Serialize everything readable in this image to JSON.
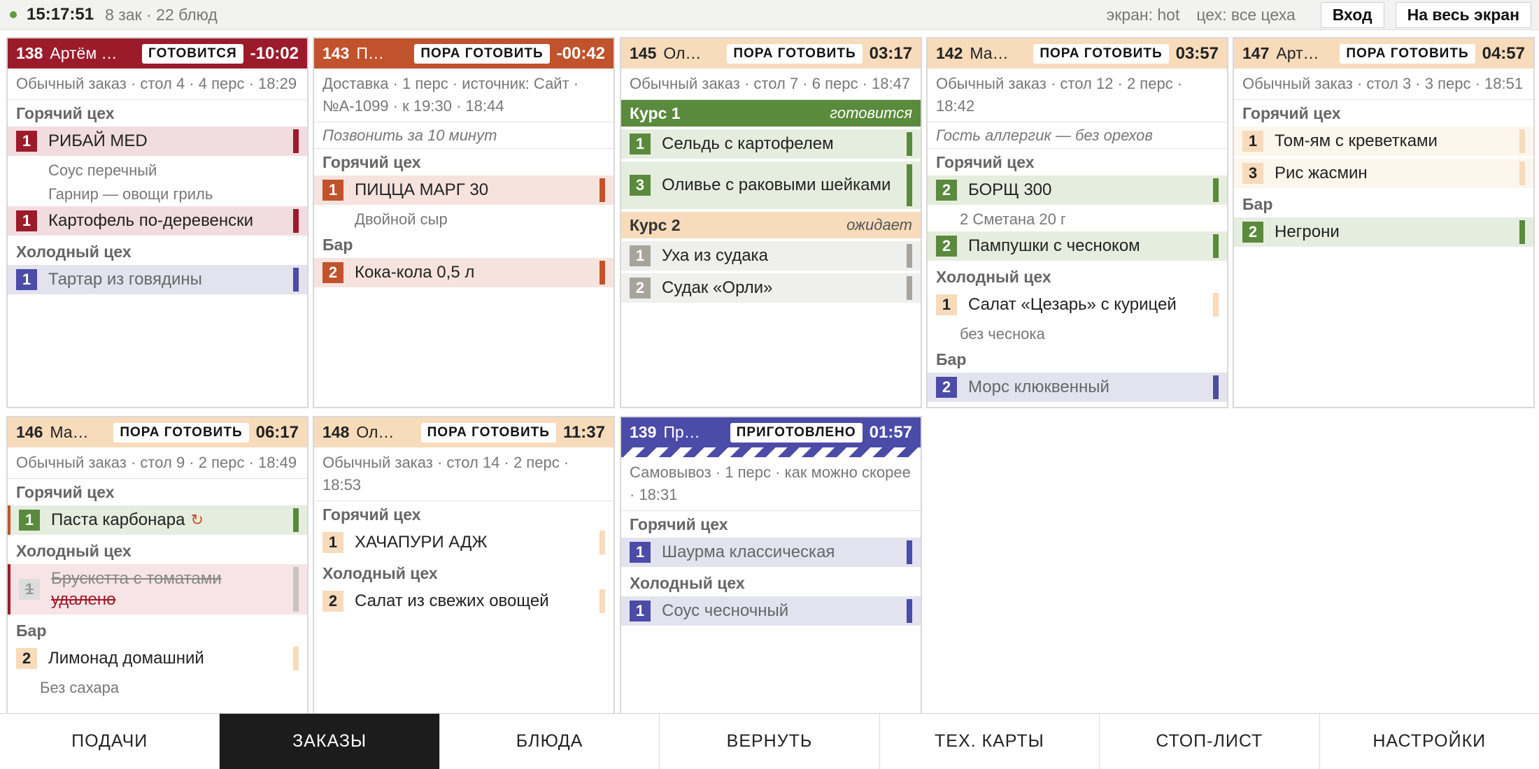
{
  "topbar": {
    "clock": "15:17:51",
    "summary": "8 зак · 22 блюд",
    "screen": "экран: hot",
    "shop": "цех: все цеха",
    "login_label": "Вход",
    "fullscreen_label": "На весь экран"
  },
  "orders": [
    {
      "num": "138",
      "name": "Артём …",
      "status": "ГОТОВИТСЯ",
      "timer": "-10:02",
      "info": "Обычный заказ  · стол 4  · 4 перс · 18:29",
      "sec1": "Горячий цех",
      "i1q": "1",
      "i1": "РИБАЙ MED",
      "m1": "Соус перечный",
      "m2": "Гарнир — овощи гриль",
      "i2q": "1",
      "i2": "Картофель по-деревенски",
      "sec2": "Холодный цех",
      "i3q": "1",
      "i3": "Тартар из говядины"
    },
    {
      "num": "143",
      "name": "П…",
      "status": "ПОРА ГОТОВИТЬ",
      "timer": "-00:42",
      "info": "Доставка  · 1 перс  · источник: Сайт · №A-1099  · к 19:30  · 18:44",
      "note": "Позвонить за 10 минут",
      "sec1": "Горячий цех",
      "i1q": "1",
      "i1": "ПИЦЦА МАРГ 30",
      "m1": "Двойной сыр",
      "sec2": "Бар",
      "i2q": "2",
      "i2": "Кока-кола 0,5 л"
    },
    {
      "num": "145",
      "name": "Ол…",
      "status": "ПОРА ГОТОВИТЬ",
      "timer": "03:17",
      "info": "Обычный заказ  · стол 7  · 6 перс · 18:47",
      "course1": "Курс 1",
      "course1_status": "готовится",
      "i1q": "1",
      "i1": "Сельдь с картофелем",
      "i2q": "3",
      "i2": "Оливье с раковыми шейками",
      "course2": "Курс 2",
      "course2_status": "ожидает",
      "i3q": "1",
      "i3": "Уха из судака",
      "i4q": "2",
      "i4": "Судак «Орли»"
    },
    {
      "num": "142",
      "name": "Ма…",
      "status": "ПОРА ГОТОВИТЬ",
      "timer": "03:57",
      "info": "Обычный заказ  · стол 12  · 2 перс · 18:42",
      "note": "Гость аллергик — без орехов",
      "sec1": "Горячий цех",
      "i1q": "2",
      "i1": "БОРЩ 300",
      "m1": "2 Сметана 20 г",
      "i2q": "2",
      "i2": "Пампушки с чесноком",
      "sec2": "Холодный цех",
      "i3q": "1",
      "i3": "Салат «Цезарь» с курицей",
      "m2": "без чеснока",
      "sec3": "Бар",
      "i4q": "2",
      "i4": "Морс клюквенный"
    },
    {
      "num": "147",
      "name": "Арт…",
      "status": "ПОРА ГОТОВИТЬ",
      "timer": "04:57",
      "info": "Обычный заказ  · стол 3  · 3 перс · 18:51",
      "sec1": "Горячий цех",
      "i1q": "1",
      "i1": "Том-ям с креветками",
      "i2q": "3",
      "i2": "Рис жасмин",
      "sec2": "Бар",
      "i3q": "2",
      "i3": "Негрони"
    },
    {
      "num": "146",
      "name": "Ма…",
      "status": "ПОРА ГОТОВИТЬ",
      "timer": "06:17",
      "info": "Обычный заказ  · стол 9  · 2 перс · 18:49",
      "sec1": "Горячий цех",
      "i1q": "1",
      "i1": "Паста карбонара",
      "redo": "↻",
      "sec2": "Холодный цех",
      "i2q": "1",
      "i2": "Брускетта с томатами",
      "removed": "удалено",
      "sec3": "Бар",
      "i3q": "2",
      "i3": "Лимонад домашний",
      "m1": "Без сахара"
    },
    {
      "num": "148",
      "name": "Ол…",
      "status": "ПОРА ГОТОВИТЬ",
      "timer": "11:37",
      "info": "Обычный заказ  · стол 14  · 2 перс · 18:53",
      "sec1": "Горячий цех",
      "i1q": "1",
      "i1": "ХАЧАПУРИ АДЖ",
      "sec2": "Холодный цех",
      "i2q": "2",
      "i2": "Салат из свежих овощей"
    },
    {
      "num": "139",
      "name": "Пр…",
      "status": "ПРИГОТОВЛЕНО",
      "timer": "01:57",
      "info": "Самовывоз  · 1 перс · как можно скорее  · 18:31",
      "sec1": "Горячий цех",
      "i1q": "1",
      "i1": "Шаурма классическая",
      "sec2": "Холодный цех",
      "i2q": "1",
      "i2": "Соус чесночный"
    }
  ],
  "nav": [
    "ПОДАЧИ",
    "ЗАКАЗЫ",
    "БЛЮДА",
    "ВЕРНУТЬ",
    "ТЕХ. КАРТЫ",
    "СТОП-ЛИСТ",
    "НАСТРОЙКИ"
  ],
  "colors": {
    "red": "#9c1b2b",
    "orange": "#c0532c",
    "peach": "#f7dbbb",
    "green": "#5a8a3c",
    "purple": "#4b4ba8",
    "grey": "#a8a49c"
  }
}
